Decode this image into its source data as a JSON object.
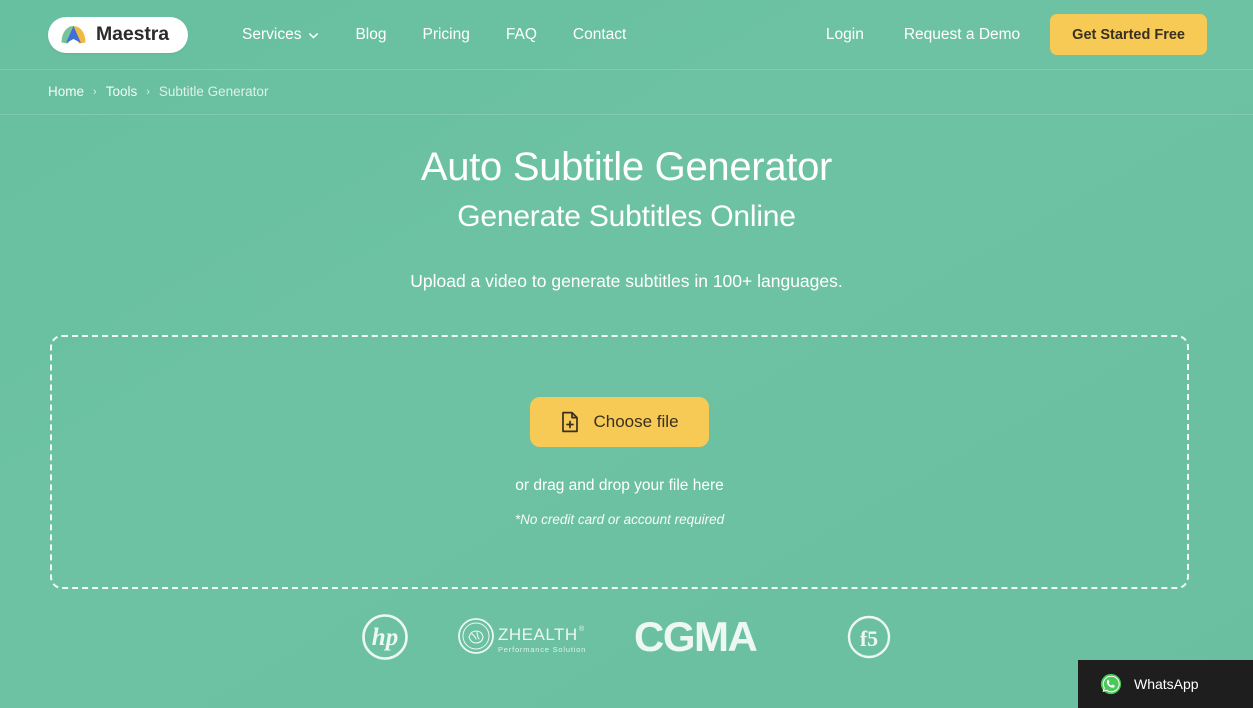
{
  "brand": {
    "name": "Maestra",
    "logo_icon": "maestra-mountain-logo",
    "colors": {
      "page_bg_green": "#6bc0a1",
      "accent_yellow": "#f6ca55",
      "logo_green": "#7ac29a",
      "logo_blue": "#3f6fd8",
      "logo_yellow": "#f0b944",
      "whatsapp_green": "#4ac959",
      "widget_bg": "#1e1e1e"
    }
  },
  "header": {
    "nav": [
      {
        "label": "Services",
        "has_dropdown": true,
        "icon": "chevron-down-icon"
      },
      {
        "label": "Blog",
        "has_dropdown": false
      },
      {
        "label": "Pricing",
        "has_dropdown": false
      },
      {
        "label": "FAQ",
        "has_dropdown": false
      },
      {
        "label": "Contact",
        "has_dropdown": false
      }
    ],
    "login_label": "Login",
    "demo_label": "Request a Demo",
    "cta_label": "Get Started Free"
  },
  "breadcrumb": {
    "separator": "›",
    "items": [
      {
        "label": "Home"
      },
      {
        "label": "Tools"
      },
      {
        "label": "Subtitle Generator"
      }
    ]
  },
  "hero": {
    "title": "Auto Subtitle Generator",
    "subtitle": "Generate Subtitles Online",
    "description": "Upload a video to generate subtitles in 100+ languages."
  },
  "uploader": {
    "button_label": "Choose file",
    "button_icon": "file-plus-icon",
    "drag_text": "or drag and drop your file here",
    "note": "*No credit card or account required"
  },
  "clients": [
    {
      "name": "hp",
      "label": "hp"
    },
    {
      "name": "zhealth",
      "label": "ZHEALTH",
      "registered": "®",
      "tagline": "Performance Solutions"
    },
    {
      "name": "cgma",
      "label": "CGMA"
    },
    {
      "name": "f5",
      "label": "f5"
    }
  ],
  "whatsapp_widget": {
    "label": "WhatsApp",
    "icon": "whatsapp-icon"
  }
}
